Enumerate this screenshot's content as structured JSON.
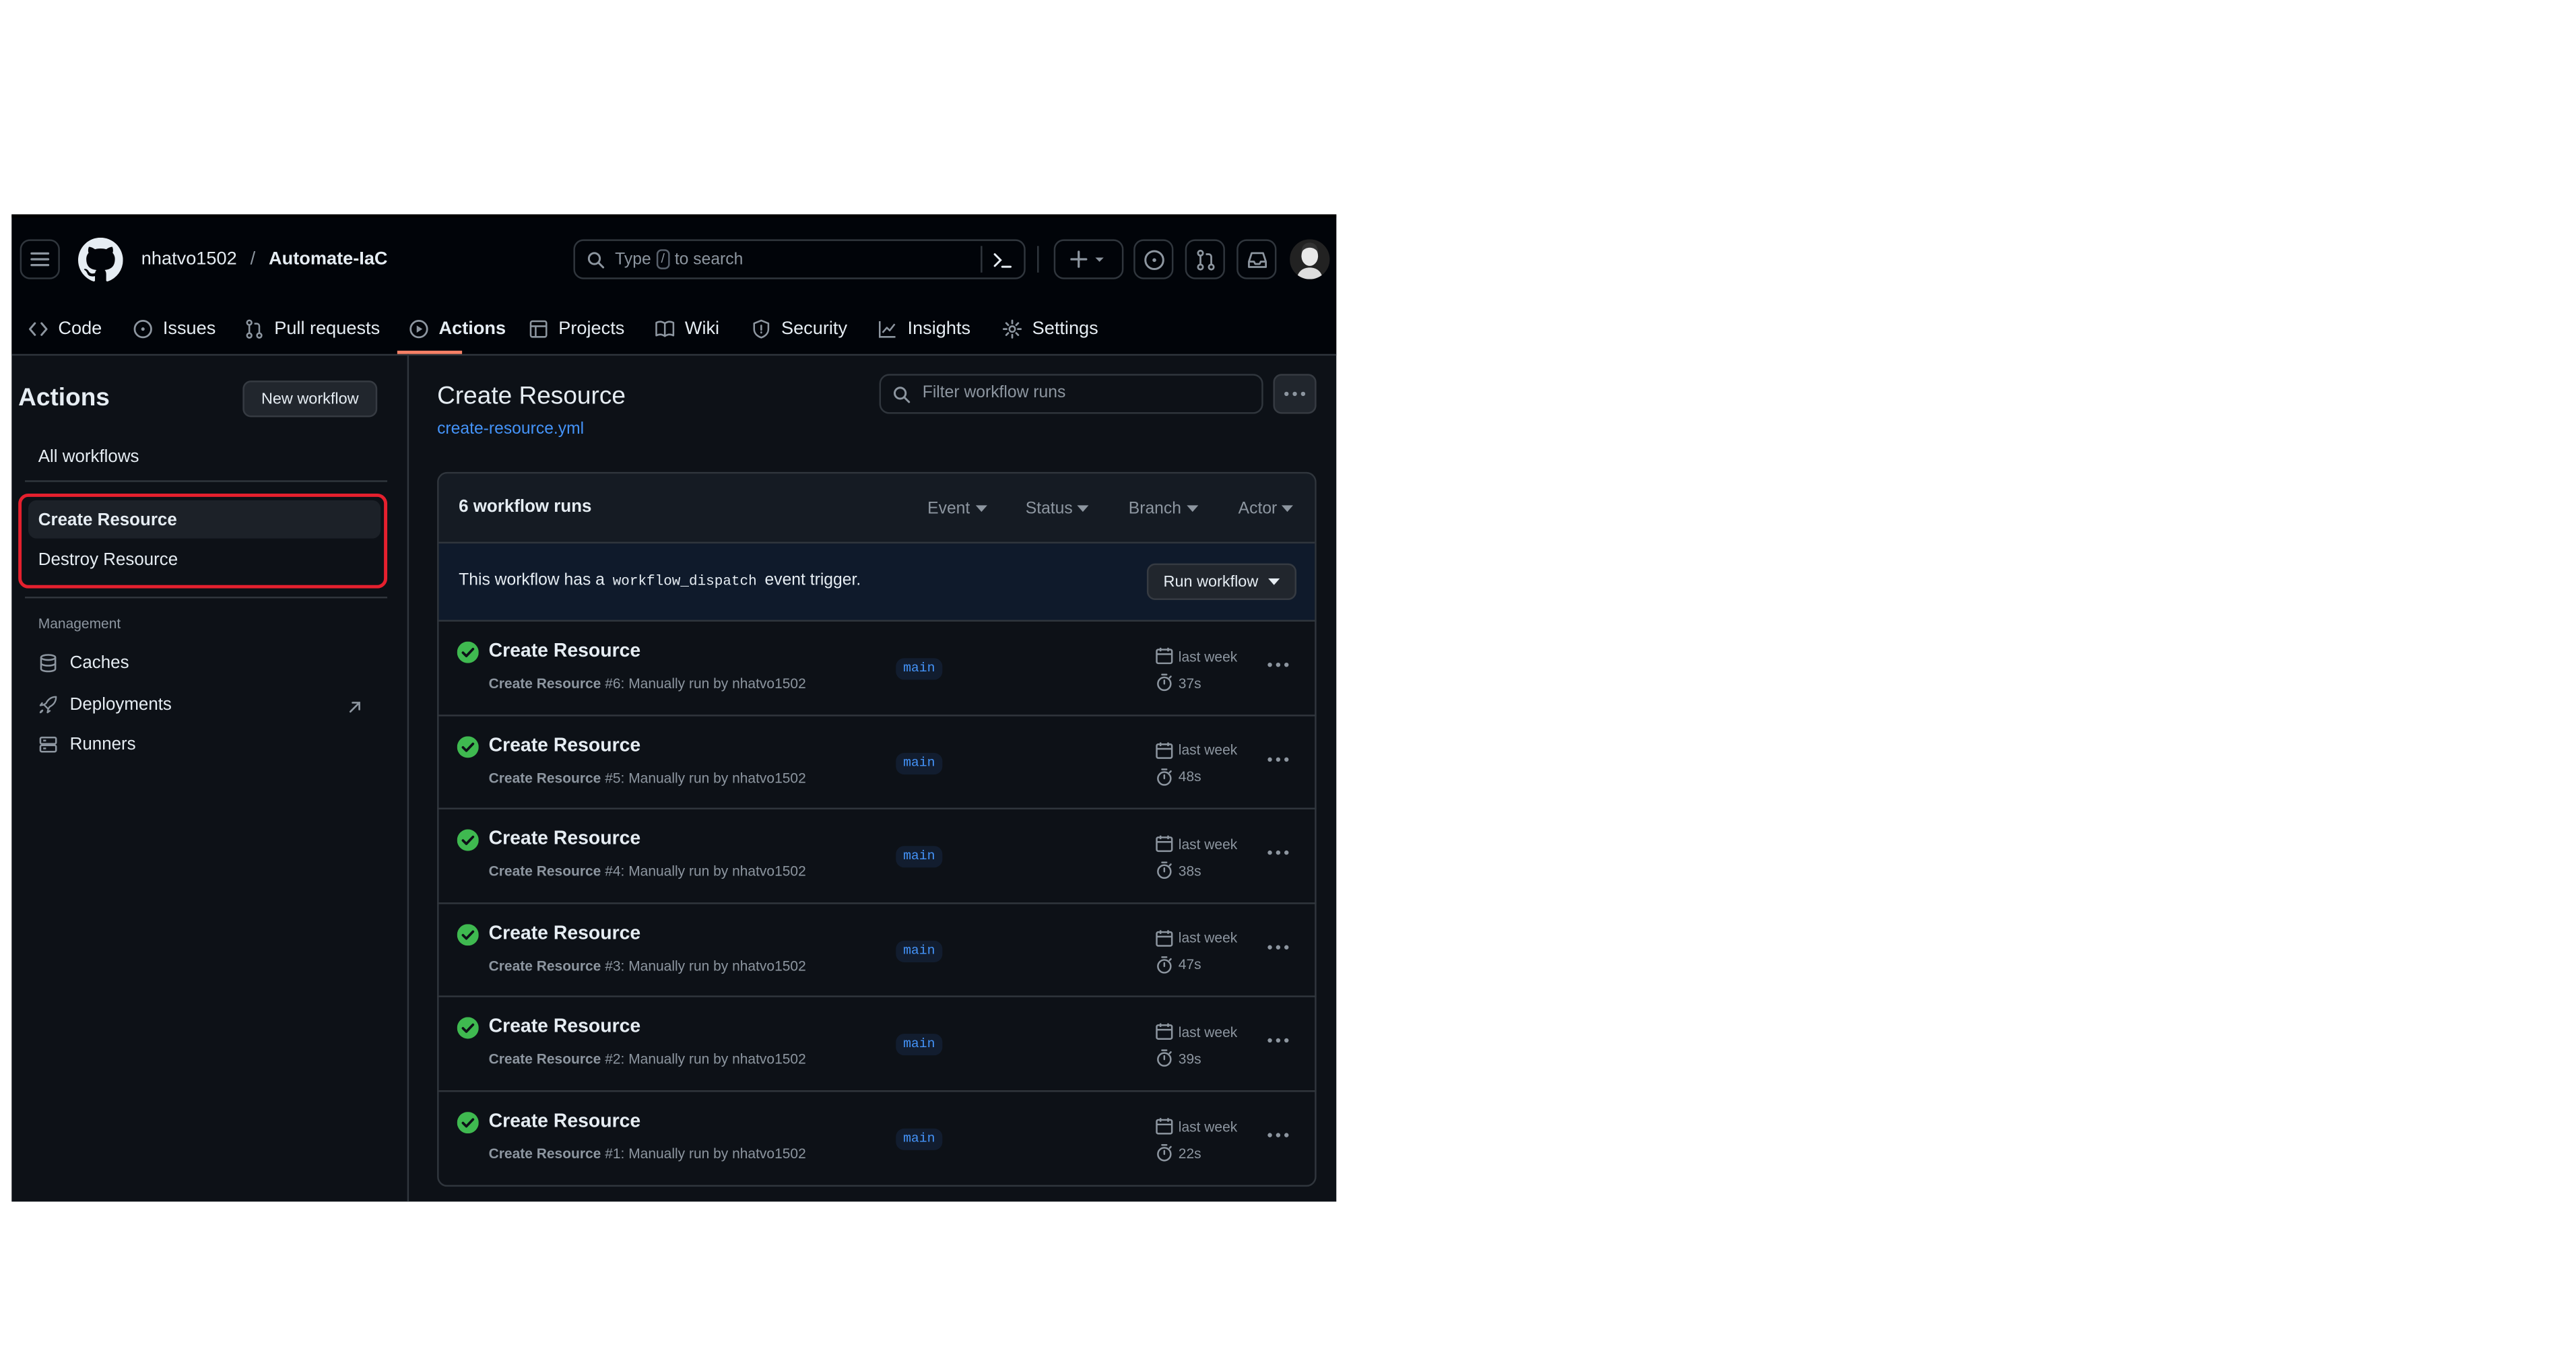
{
  "header": {
    "owner": "nhatvo1502",
    "separator": "/",
    "repo": "Automate-IaC",
    "search_placeholder_parts": [
      "Type",
      "/",
      "to search"
    ]
  },
  "tabs": [
    {
      "label": "Code"
    },
    {
      "label": "Issues"
    },
    {
      "label": "Pull requests"
    },
    {
      "label": "Actions"
    },
    {
      "label": "Projects"
    },
    {
      "label": "Wiki"
    },
    {
      "label": "Security"
    },
    {
      "label": "Insights"
    },
    {
      "label": "Settings"
    }
  ],
  "sidebar": {
    "title": "Actions",
    "new_workflow": "New workflow",
    "all_workflows": "All workflows",
    "workflows": [
      "Create Resource",
      "Destroy Resource"
    ],
    "management_label": "Management",
    "management": [
      "Caches",
      "Deployments",
      "Runners"
    ],
    "highlight_color": "#e5202e"
  },
  "main": {
    "title": "Create Resource",
    "file": "create-resource.yml",
    "filter_placeholder": "Filter workflow runs",
    "runs_count": "6 workflow runs",
    "filters": [
      "Event",
      "Status",
      "Branch",
      "Actor"
    ],
    "dispatch_text_before": "This workflow has a",
    "dispatch_code": "workflow_dispatch",
    "dispatch_text_after": "event trigger.",
    "run_workflow": "Run workflow",
    "runs": [
      {
        "title": "Create Resource",
        "sub_name": "Create Resource",
        "sub_rest": "#6: Manually run by nhatvo1502",
        "branch": "main",
        "date": "last week",
        "duration": "37s"
      },
      {
        "title": "Create Resource",
        "sub_name": "Create Resource",
        "sub_rest": "#5: Manually run by nhatvo1502",
        "branch": "main",
        "date": "last week",
        "duration": "48s"
      },
      {
        "title": "Create Resource",
        "sub_name": "Create Resource",
        "sub_rest": "#4: Manually run by nhatvo1502",
        "branch": "main",
        "date": "last week",
        "duration": "38s"
      },
      {
        "title": "Create Resource",
        "sub_name": "Create Resource",
        "sub_rest": "#3: Manually run by nhatvo1502",
        "branch": "main",
        "date": "last week",
        "duration": "47s"
      },
      {
        "title": "Create Resource",
        "sub_name": "Create Resource",
        "sub_rest": "#2: Manually run by nhatvo1502",
        "branch": "main",
        "date": "last week",
        "duration": "39s"
      },
      {
        "title": "Create Resource",
        "sub_name": "Create Resource",
        "sub_rest": "#1: Manually run by nhatvo1502",
        "branch": "main",
        "date": "last week",
        "duration": "22s"
      }
    ]
  },
  "colors": {
    "background": "#0d1117",
    "accent": "#4493f8",
    "success": "#3fb950",
    "tab_underline": "#f78166"
  }
}
